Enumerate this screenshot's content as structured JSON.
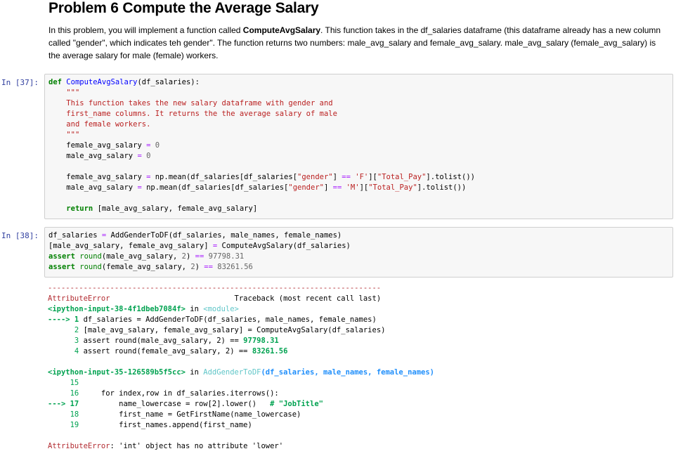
{
  "markdown": {
    "title": "Problem 6 Compute the Average Salary",
    "para_1": "In this problem, you will implement a function called ",
    "para_func": "ComputeAvgSalary",
    "para_2": ". This function takes in the df_salaries dataframe (this dataframe already has a new column called \"gender\", which indicates teh gender\". The function returns two numbers: male_avg_salary and female_avg_salary. male_avg_salary (female_avg_salary) is the average salary for male (female) workers."
  },
  "cells": [
    {
      "prompt": "In [37]:"
    },
    {
      "prompt": "In [38]:"
    }
  ],
  "code37": {
    "def_kw": "def",
    "func_name": "ComputeAvgSalary",
    "args": "(df_salaries):",
    "doc_q1": "\"\"\"",
    "doc_1": "This function takes the new salary dataframe with gender and",
    "doc_2": "first_name columns. It returns the the average salary of male",
    "doc_3": "and female workers.",
    "doc_q2": "\"\"\"",
    "l_f0": "female_avg_salary",
    "l_m0": "male_avg_salary",
    "assign": " = ",
    "zero": "0",
    "l_fm_a": "female_avg_salary",
    "l_fm_b": "np.mean(df_salaries[df_salaries[",
    "gender_str": "\"gender\"",
    "eqeq": "==",
    "f_str": "'F'",
    "total_pay": "\"Total_Pay\"",
    "tolist": "].tolist())",
    "l_mm_a": "male_avg_salary",
    "m_str": "'M'",
    "return_kw": "return",
    "return_val": "[male_avg_salary, female_avg_salary]"
  },
  "code38": {
    "line1_a": "df_salaries",
    "line1_b": "AddGenderToDF(df_salaries, male_names, female_names)",
    "line2_a": "[male_avg_salary, female_avg_salary]",
    "line2_b": "ComputeAvgSalary(df_salaries)",
    "assert_kw": "assert",
    "round_fn": "round",
    "line3_args": "(male_avg_salary, ",
    "two": "2",
    "line3_num": "97798.31",
    "line4_args": "(female_avg_salary, ",
    "line4_num": "83261.56"
  },
  "output": {
    "dashes": "---------------------------------------------------------------------------",
    "error_name": "AttributeError",
    "traceback_label": "Traceback (most recent call last)",
    "frame1_file": "<ipython-input-38-4f1dbeb7084f>",
    "in_word": "in",
    "frame1_scope": "<module>",
    "f1_arrow": "----> 1",
    "f1_l1": "df_salaries = AddGenderToDF(df_salaries, male_names, female_names)",
    "f1_n2": "      2",
    "f1_l2": "[male_avg_salary, female_avg_salary] = ComputeAvgSalary(df_salaries)",
    "f1_n3": "      3",
    "f1_l3_a": "assert round(male_avg_salary, 2) == ",
    "f1_l3_b": "97798.31",
    "f1_n4": "      4",
    "f1_l4_a": "assert round(female_avg_salary, 2) == ",
    "f1_l4_b": "83261.56",
    "frame2_file": "<ipython-input-35-126589b5f5cc>",
    "frame2_func": "AddGenderToDF",
    "frame2_args": "(df_salaries, male_names, female_names)",
    "f2_n15": "     15",
    "f2_n16": "     16",
    "f2_l16": "    for index,row in df_salaries.iterrows():",
    "f2_arrow": "---> 17",
    "f2_l17_a": "        name_lowercase = row[2].lower()",
    "f2_l17_b": "   # \"JobTitle\"",
    "f2_n18": "     18",
    "f2_l18": "        first_name = GetFirstName(name_lowercase)",
    "f2_n19": "     19",
    "f2_l19": "        first_names.append(first_name)",
    "final_error": "AttributeError",
    "final_msg": ": 'int' object has no attribute 'lower'"
  }
}
